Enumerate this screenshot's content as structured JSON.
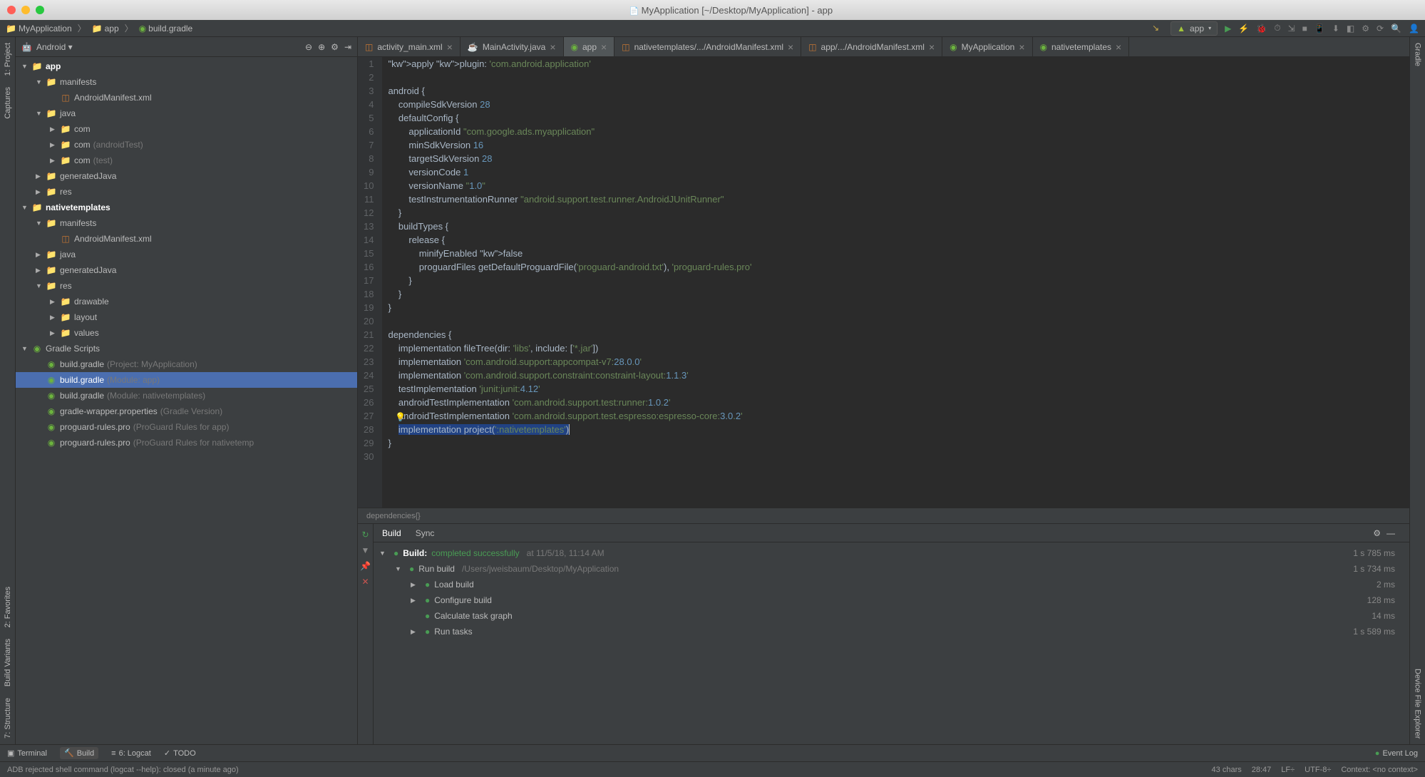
{
  "window": {
    "title": "MyApplication [~/Desktop/MyApplication] - app"
  },
  "breadcrumb": {
    "items": [
      "MyApplication",
      "app",
      "build.gradle"
    ]
  },
  "run_config": {
    "label": "app"
  },
  "project": {
    "view_label": "Android",
    "tree": [
      {
        "d": 0,
        "a": "▼",
        "i": "folder",
        "t": "app",
        "cls": "bold"
      },
      {
        "d": 1,
        "a": "▼",
        "i": "folder",
        "t": "manifests"
      },
      {
        "d": 2,
        "a": "",
        "i": "xml",
        "t": "AndroidManifest.xml"
      },
      {
        "d": 1,
        "a": "▼",
        "i": "folder",
        "t": "java"
      },
      {
        "d": 2,
        "a": "▶",
        "i": "folder",
        "t": "com"
      },
      {
        "d": 2,
        "a": "▶",
        "i": "folder",
        "t": "com",
        "hint": "(androidTest)"
      },
      {
        "d": 2,
        "a": "▶",
        "i": "folder",
        "t": "com",
        "hint": "(test)"
      },
      {
        "d": 1,
        "a": "▶",
        "i": "folder",
        "t": "generatedJava"
      },
      {
        "d": 1,
        "a": "▶",
        "i": "folder",
        "t": "res"
      },
      {
        "d": 0,
        "a": "▼",
        "i": "folder",
        "t": "nativetemplates",
        "cls": "bold"
      },
      {
        "d": 1,
        "a": "▼",
        "i": "folder",
        "t": "manifests"
      },
      {
        "d": 2,
        "a": "",
        "i": "xml",
        "t": "AndroidManifest.xml"
      },
      {
        "d": 1,
        "a": "▶",
        "i": "folder",
        "t": "java"
      },
      {
        "d": 1,
        "a": "▶",
        "i": "folder",
        "t": "generatedJava"
      },
      {
        "d": 1,
        "a": "▼",
        "i": "folder",
        "t": "res"
      },
      {
        "d": 2,
        "a": "▶",
        "i": "folder",
        "t": "drawable"
      },
      {
        "d": 2,
        "a": "▶",
        "i": "folder",
        "t": "layout"
      },
      {
        "d": 2,
        "a": "▶",
        "i": "folder",
        "t": "values"
      },
      {
        "d": 0,
        "a": "▼",
        "i": "gradle",
        "t": "Gradle Scripts"
      },
      {
        "d": 1,
        "a": "",
        "i": "gradle",
        "t": "build.gradle",
        "hint": "(Project: MyApplication)"
      },
      {
        "d": 1,
        "a": "",
        "i": "gradle",
        "t": "build.gradle",
        "hint": "(Module: app)",
        "sel": true
      },
      {
        "d": 1,
        "a": "",
        "i": "gradle",
        "t": "build.gradle",
        "hint": "(Module: nativetemplates)"
      },
      {
        "d": 1,
        "a": "",
        "i": "gradle",
        "t": "gradle-wrapper.properties",
        "hint": "(Gradle Version)"
      },
      {
        "d": 1,
        "a": "",
        "i": "gradle",
        "t": "proguard-rules.pro",
        "hint": "(ProGuard Rules for app)"
      },
      {
        "d": 1,
        "a": "",
        "i": "gradle",
        "t": "proguard-rules.pro",
        "hint": "(ProGuard Rules for nativetemp"
      }
    ]
  },
  "tabs": [
    {
      "icon": "xml",
      "label": "activity_main.xml"
    },
    {
      "icon": "java",
      "label": "MainActivity.java"
    },
    {
      "icon": "gradle",
      "label": "app",
      "active": true
    },
    {
      "icon": "xml",
      "label": "nativetemplates/.../AndroidManifest.xml"
    },
    {
      "icon": "xml",
      "label": "app/.../AndroidManifest.xml"
    },
    {
      "icon": "gradle",
      "label": "MyApplication"
    },
    {
      "icon": "gradle",
      "label": "nativetemplates"
    }
  ],
  "editor": {
    "lines": [
      "apply plugin: 'com.android.application'",
      "",
      "android {",
      "    compileSdkVersion 28",
      "    defaultConfig {",
      "        applicationId \"com.google.ads.myapplication\"",
      "        minSdkVersion 16",
      "        targetSdkVersion 28",
      "        versionCode 1",
      "        versionName \"1.0\"",
      "        testInstrumentationRunner \"android.support.test.runner.AndroidJUnitRunner\"",
      "    }",
      "    buildTypes {",
      "        release {",
      "            minifyEnabled false",
      "            proguardFiles getDefaultProguardFile('proguard-android.txt'), 'proguard-rules.pro'",
      "        }",
      "    }",
      "}",
      "",
      "dependencies {",
      "    implementation fileTree(dir: 'libs', include: ['*.jar'])",
      "    implementation 'com.android.support:appcompat-v7:28.0.0'",
      "    implementation 'com.android.support.constraint:constraint-layout:1.1.3'",
      "    testImplementation 'junit:junit:4.12'",
      "    androidTestImplementation 'com.android.support.test:runner:1.0.2'",
      "    androidTestImplementation 'com.android.support.test.espresso:espresso-core:3.0.2'",
      "    implementation project(':nativetemplates')",
      "}",
      ""
    ],
    "footer_hint": "dependencies{}"
  },
  "build_panel": {
    "tabs": [
      "Build",
      "Sync"
    ],
    "rows": [
      {
        "d": 0,
        "a": "▼",
        "ok": true,
        "bold": true,
        "t": "Build:",
        "status": "completed successfully",
        "hint": "at 11/5/18, 11:14 AM",
        "time": "1 s 785 ms"
      },
      {
        "d": 1,
        "a": "▼",
        "ok": true,
        "t": "Run build",
        "hint": "/Users/jweisbaum/Desktop/MyApplication",
        "time": "1 s 734 ms"
      },
      {
        "d": 2,
        "a": "▶",
        "ok": true,
        "t": "Load build",
        "time": "2 ms"
      },
      {
        "d": 2,
        "a": "▶",
        "ok": true,
        "t": "Configure build",
        "time": "128 ms"
      },
      {
        "d": 2,
        "a": "",
        "ok": true,
        "t": "Calculate task graph",
        "time": "14 ms"
      },
      {
        "d": 2,
        "a": "▶",
        "ok": true,
        "t": "Run tasks",
        "time": "1 s 589 ms"
      }
    ]
  },
  "bottom_toolbar": {
    "items": [
      {
        "label": "Terminal",
        "icon": "▣"
      },
      {
        "label": "Build",
        "icon": "🔨",
        "active": true
      },
      {
        "label": "6: Logcat",
        "icon": "≡"
      },
      {
        "label": "TODO",
        "icon": "✓"
      }
    ],
    "event_log": "Event Log"
  },
  "status": {
    "message": "ADB rejected shell command (logcat --help): closed (a minute ago)",
    "right": [
      "43 chars",
      "28:47",
      "LF÷",
      "UTF-8÷",
      "Context: <no context>"
    ]
  },
  "left_gutter": [
    "1: Project",
    "Captures",
    "2: Favorites",
    "Build Variants",
    "7: Structure"
  ],
  "right_gutter": [
    "Gradle",
    "Device File Explorer"
  ]
}
